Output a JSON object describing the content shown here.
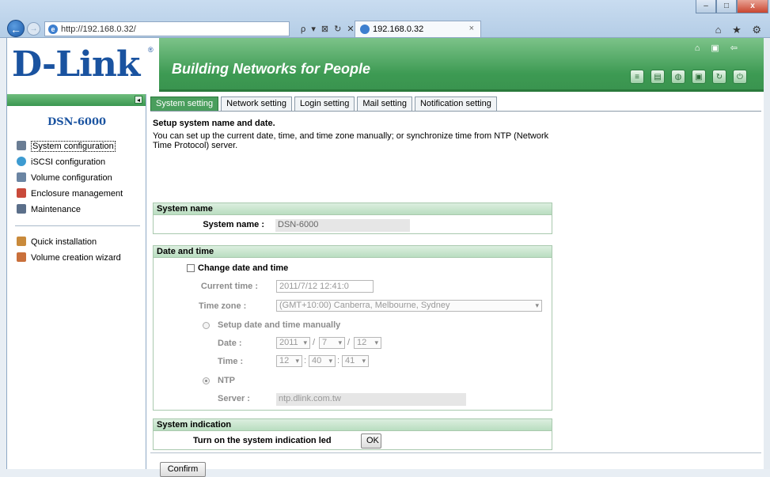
{
  "browser": {
    "address": "http://192.168.0.32/",
    "search_controls": "ρ ▾ ⊠ ↻ ✕",
    "tab_title": "192.168.0.32",
    "window_buttons": [
      "–",
      "□",
      "x"
    ],
    "toolbar_icons": "⌂ ★ ⚙"
  },
  "header": {
    "logo": "D-Link",
    "logo_mark": "®",
    "slogan": "Building Networks for People",
    "top_icons": [
      "home-icon",
      "bookmark-icon",
      "logout-icon"
    ],
    "tool_icons": [
      "database-icon",
      "document-icon",
      "globe-icon",
      "save-icon",
      "refresh-icon",
      "power-icon"
    ]
  },
  "sidebar": {
    "collapse_label": "◂",
    "model": "DSN-6000",
    "items": [
      {
        "label": "System configuration",
        "icon": "system-icon",
        "color": "#6a7d94"
      },
      {
        "label": "iSCSI configuration",
        "icon": "iscsi-icon",
        "color": "#3d9bd1"
      },
      {
        "label": "Volume configuration",
        "icon": "volume-icon",
        "color": "#6b85a3"
      },
      {
        "label": "Enclosure management",
        "icon": "enclosure-icon",
        "color": "#c94a3b"
      },
      {
        "label": "Maintenance",
        "icon": "maintenance-icon",
        "color": "#5b6f8a"
      },
      {
        "label": "Quick installation",
        "icon": "quick-install-icon",
        "color": "#c98a3b"
      },
      {
        "label": "Volume creation wizard",
        "icon": "wizard-icon",
        "color": "#c9703b"
      }
    ]
  },
  "tabs": [
    "System setting",
    "Network setting",
    "Login setting",
    "Mail setting",
    "Notification setting"
  ],
  "main": {
    "title": "Setup system name and date.",
    "description": "You can set up the current date, time, and time zone manually; or synchronize time from NTP (Network Time Protocol) server.",
    "system_name": {
      "header": "System name",
      "label": "System name :",
      "value": "DSN-6000"
    },
    "date_time": {
      "header": "Date and time",
      "change_label": "Change date and time",
      "current_time_label": "Current time :",
      "current_time_value": "2011/7/12 12:41:0",
      "timezone_label": "Time zone :",
      "timezone_value": "(GMT+10:00) Canberra, Melbourne, Sydney",
      "manual_label": "Setup date and time manually",
      "date_label": "Date :",
      "year": "2011",
      "month": "7",
      "day": "12",
      "sep_slash": "/",
      "time_label": "Time :",
      "hour": "12",
      "minute": "40",
      "second": "41",
      "sep_colon": ":",
      "ntp_label": "NTP",
      "server_label": "Server :",
      "server_value": "ntp.dlink.com.tw"
    },
    "indication": {
      "header": "System indication",
      "label": "Turn on the system indication led",
      "button": "OK"
    },
    "confirm": "Confirm"
  }
}
